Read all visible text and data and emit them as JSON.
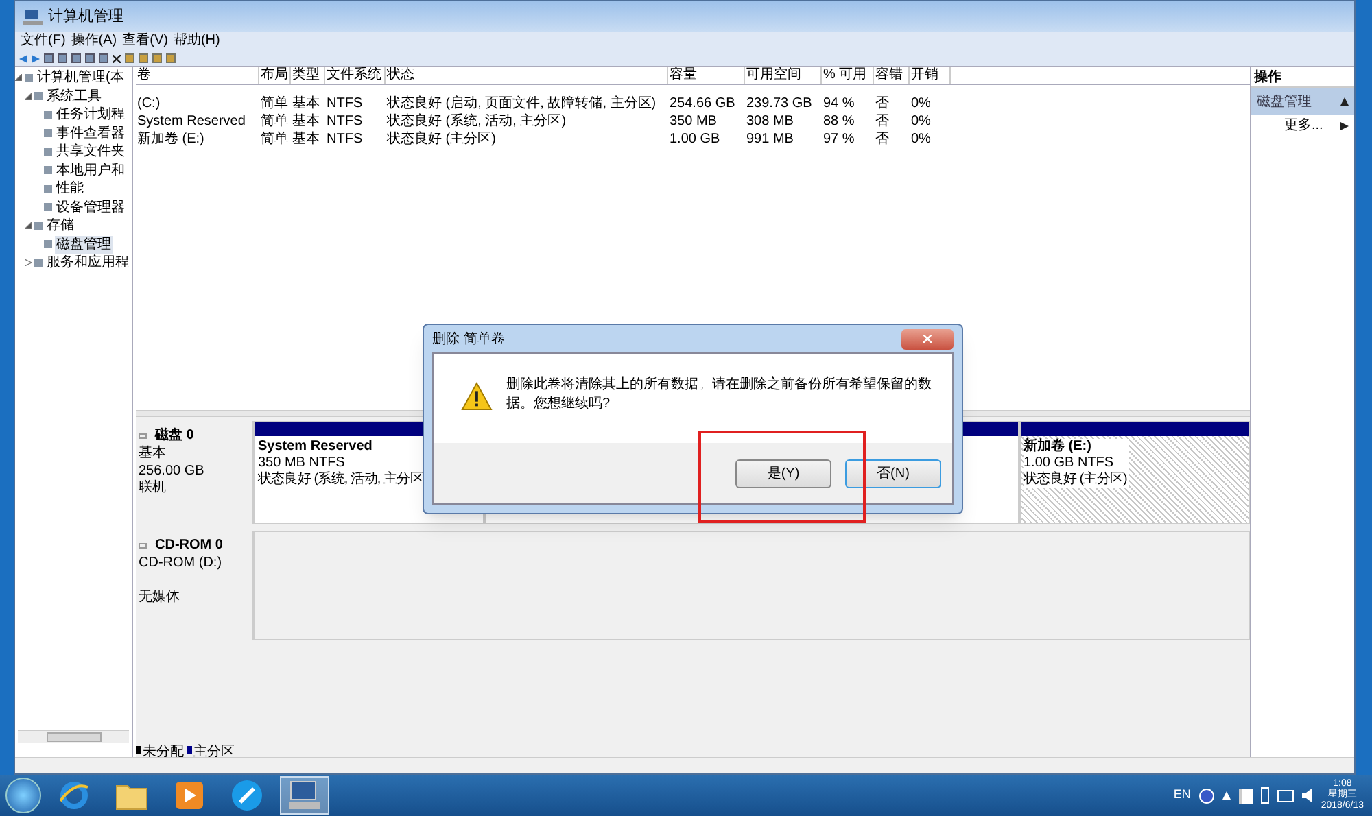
{
  "window": {
    "title": "计算机管理"
  },
  "menu": [
    "文件(F)",
    "操作(A)",
    "查看(V)",
    "帮助(H)"
  ],
  "tree": [
    {
      "label": "计算机管理(本",
      "selected": false,
      "expanded": true,
      "children": [
        {
          "label": "系统工具",
          "selected": false,
          "expanded": true,
          "children": [
            {
              "label": "任务计划程",
              "selected": false
            },
            {
              "label": "事件查看器",
              "selected": false
            },
            {
              "label": "共享文件夹",
              "selected": false
            },
            {
              "label": "本地用户和",
              "selected": false
            },
            {
              "label": "性能",
              "selected": false
            },
            {
              "label": "设备管理器",
              "selected": false
            }
          ]
        },
        {
          "label": "存储",
          "selected": false,
          "expanded": true,
          "children": [
            {
              "label": "磁盘管理",
              "selected": true
            }
          ]
        },
        {
          "label": "服务和应用程",
          "selected": false,
          "expanded": false
        }
      ]
    }
  ],
  "table": {
    "columns": [
      "卷",
      "布局",
      "类型",
      "文件系统",
      "状态",
      "容量",
      "可用空间",
      "% 可用",
      "容错",
      "开销"
    ],
    "rows": [
      [
        "(C:)",
        "简单",
        "基本",
        "NTFS",
        "状态良好 (启动, 页面文件, 故障转储, 主分区)",
        "254.66 GB",
        "239.73 GB",
        "94 %",
        "否",
        "0%"
      ],
      [
        "System Reserved",
        "简单",
        "基本",
        "NTFS",
        "状态良好 (系统, 活动, 主分区)",
        "350 MB",
        "308 MB",
        "88 %",
        "否",
        "0%"
      ],
      [
        "新加卷 (E:)",
        "简单",
        "基本",
        "NTFS",
        "状态良好 (主分区)",
        "1.00 GB",
        "991 MB",
        "97 %",
        "否",
        "0%"
      ]
    ]
  },
  "actions": {
    "title": "操作",
    "section": "磁盘管理",
    "items": [
      "更多..."
    ]
  },
  "disks": [
    {
      "kind": "disk",
      "name": "磁盘 0",
      "lines": [
        "基本",
        "256.00 GB",
        "联机"
      ],
      "partitions": [
        {
          "name": "System Reserved",
          "size": "350 MB NTFS",
          "status": "状态良好 (系统, 活动, 主分区",
          "selected": false
        },
        {
          "selected": false
        },
        {
          "name": "新加卷 (E:)",
          "size": "1.00 GB NTFS",
          "status": "状态良好 (主分区)",
          "selected": true
        }
      ]
    },
    {
      "kind": "cdrom",
      "name": "CD-ROM 0",
      "lines": [
        "CD-ROM (D:)",
        "无媒体"
      ]
    }
  ],
  "legend": [
    {
      "label": "未分配",
      "color": "#000000"
    },
    {
      "label": "主分区",
      "color": "#00008b"
    }
  ],
  "dialog": {
    "title": "删除 简单卷",
    "message": "删除此卷将清除其上的所有数据。请在删除之前备份所有希望保留的数据。您想继续吗?",
    "buttons": [
      {
        "label": "是(Y)",
        "default": false
      },
      {
        "label": "否(N)",
        "default": true
      }
    ]
  },
  "taskbar": {
    "apps": [
      {
        "kind": "ie",
        "selected": false
      },
      {
        "kind": "folder",
        "selected": false
      },
      {
        "kind": "media",
        "selected": false
      },
      {
        "kind": "app",
        "selected": false
      },
      {
        "kind": "computer",
        "selected": true
      }
    ],
    "language": "EN",
    "time": "1:08",
    "weekday": "星期三",
    "date": "2018/6/13"
  }
}
